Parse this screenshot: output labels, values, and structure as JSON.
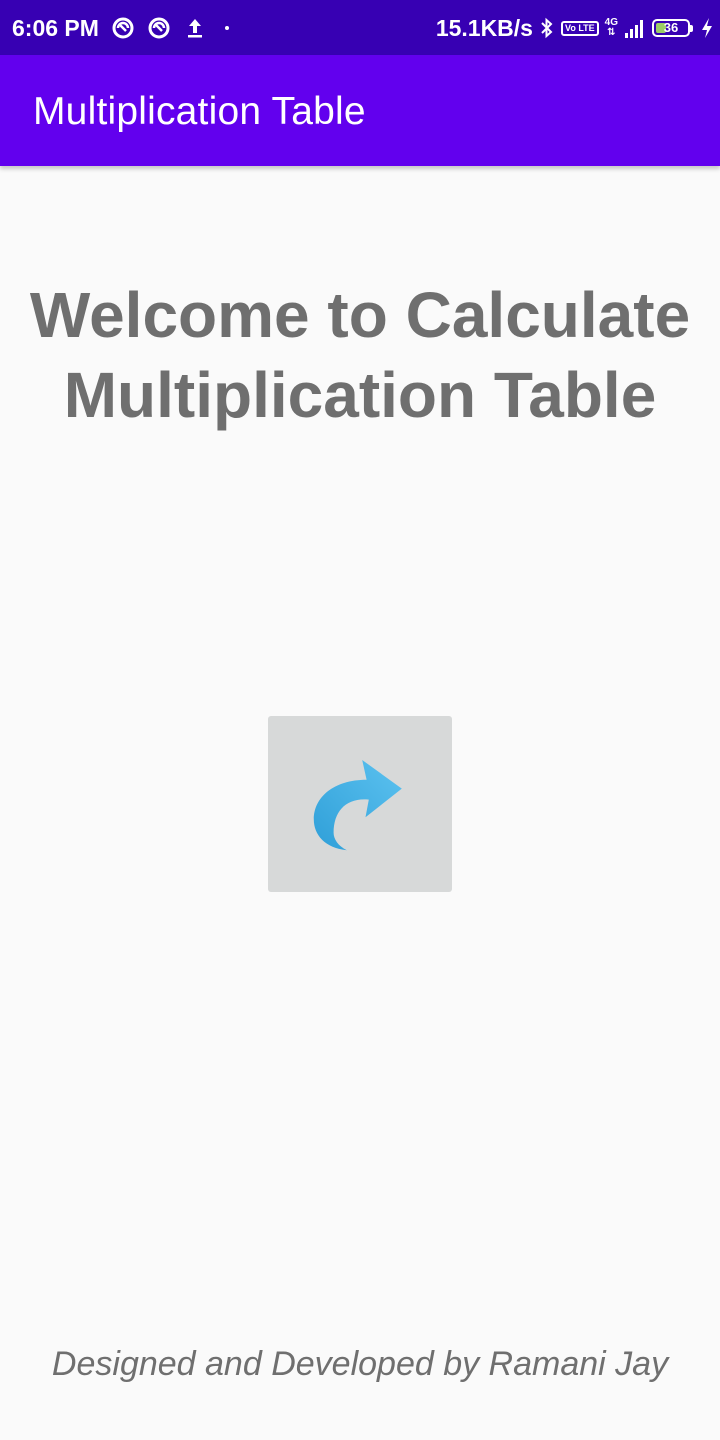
{
  "status_bar": {
    "time": "6:06 PM",
    "network_speed": "15.1KB/s",
    "volte_label": "Vo LTE",
    "network_type": "4G",
    "battery_level": "36",
    "icons": [
      "data-saver-icon",
      "data-saver-icon",
      "upload-icon",
      "notification-dot-icon",
      "bluetooth-icon",
      "volte-icon",
      "signal-icon",
      "battery-icon",
      "charging-icon"
    ],
    "background_color": "#3700b3"
  },
  "app_bar": {
    "title": "Multiplication Table",
    "background_color": "#6200ee"
  },
  "main": {
    "welcome_line1": "Welcome to Calculate",
    "welcome_line2": "Multiplication Table",
    "forward_button_icon": "forward-arrow-icon",
    "forward_button_background": "#d7d9d9"
  },
  "footer": {
    "credit": "Designed and Developed by Ramani Jay"
  }
}
